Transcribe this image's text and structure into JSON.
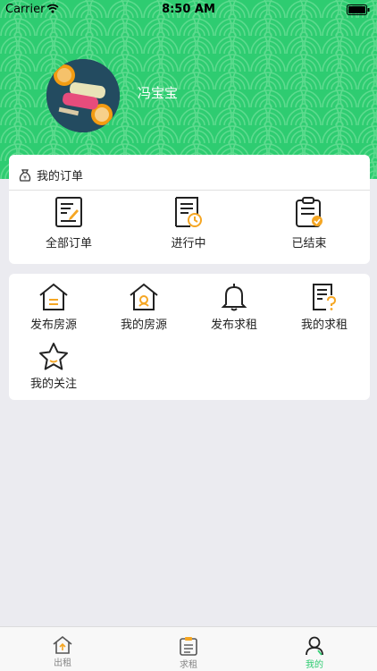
{
  "status_bar": {
    "carrier": "Carrier",
    "time": "8:50 AM"
  },
  "header": {
    "username": "冯宝宝",
    "background_color": "#2ECC71"
  },
  "orders": {
    "title": "我的订单",
    "items": [
      {
        "label": "全部订单",
        "icon": "order-list-icon"
      },
      {
        "label": "进行中",
        "icon": "order-in-progress-icon"
      },
      {
        "label": "已结束",
        "icon": "order-finished-icon"
      }
    ]
  },
  "services": {
    "items": [
      {
        "label": "发布房源",
        "icon": "house-publish-icon"
      },
      {
        "label": "我的房源",
        "icon": "my-house-icon"
      },
      {
        "label": "发布求租",
        "icon": "bell-icon"
      },
      {
        "label": "我的求租",
        "icon": "document-question-icon"
      },
      {
        "label": "我的关注",
        "icon": "star-icon"
      }
    ]
  },
  "tabbar": {
    "tabs": [
      {
        "label": "出租",
        "icon": "house-icon",
        "active": false
      },
      {
        "label": "求租",
        "icon": "clipboard-icon",
        "active": false
      },
      {
        "label": "我的",
        "icon": "person-icon",
        "active": true
      }
    ],
    "accent_color": "#2ECC71"
  }
}
